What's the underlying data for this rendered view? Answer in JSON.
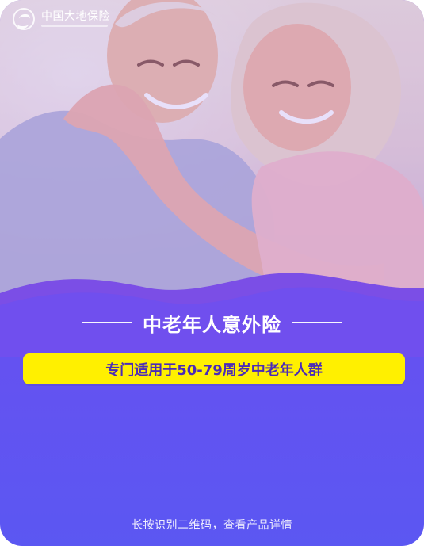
{
  "brand": {
    "name": "中国大地保险",
    "logo_icon": "circle-brand-icon"
  },
  "hero": {
    "photo_icon": "elderly-couple-photo"
  },
  "content": {
    "title": "中老年人意外险",
    "subtitle": "专门适用于50-79周岁中老年人群",
    "footer": "长按识别二维码，查看产品详情"
  },
  "colors": {
    "background": "#6a4ff0",
    "accent_yellow": "#fff000",
    "pill_text": "#4b2bb8"
  }
}
